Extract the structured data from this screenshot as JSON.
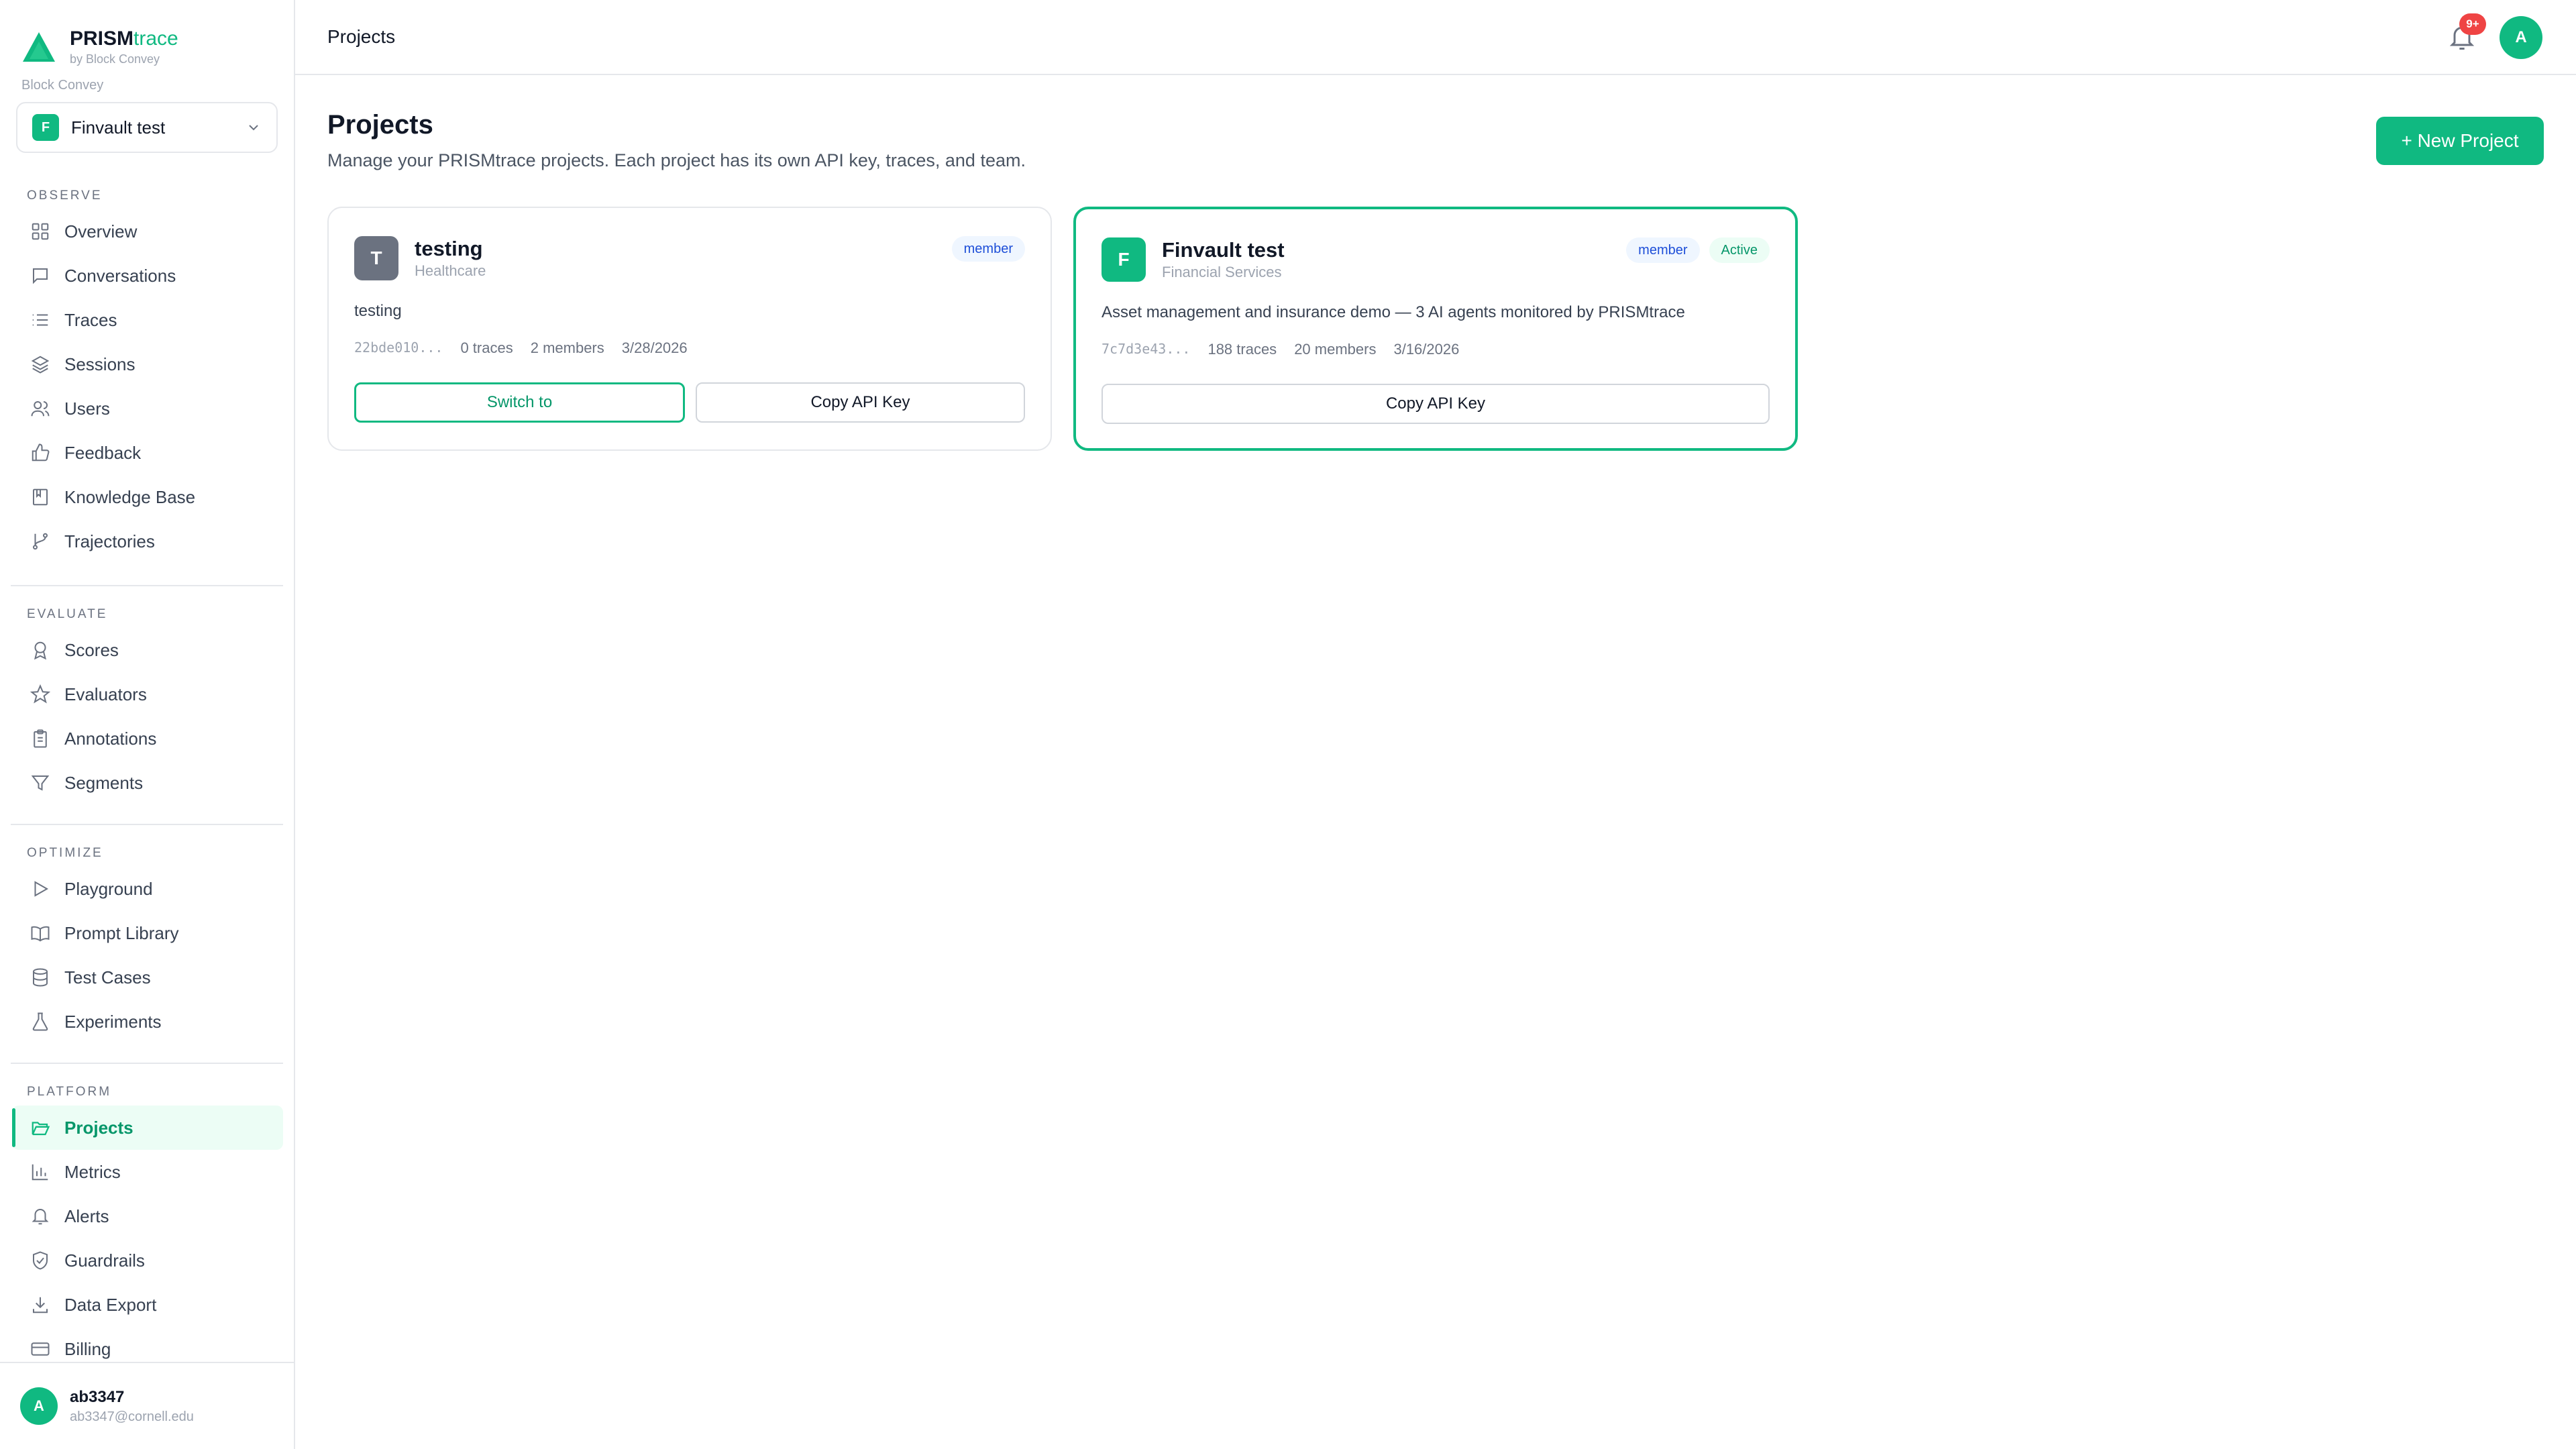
{
  "brand": {
    "name_main": "PRISM",
    "name_accent": "trace",
    "subtitle": "by Block Convey",
    "org": "Block Convey"
  },
  "project_selector": {
    "avatar": "F",
    "name": "Finvault test"
  },
  "sections": {
    "observe": "OBSERVE",
    "evaluate": "EVALUATE",
    "optimize": "OPTIMIZE",
    "platform": "PLATFORM"
  },
  "nav": {
    "overview": "Overview",
    "conversations": "Conversations",
    "traces": "Traces",
    "sessions": "Sessions",
    "users": "Users",
    "feedback": "Feedback",
    "knowledge_base": "Knowledge Base",
    "trajectories": "Trajectories",
    "scores": "Scores",
    "evaluators": "Evaluators",
    "annotations": "Annotations",
    "segments": "Segments",
    "playground": "Playground",
    "prompt_library": "Prompt Library",
    "test_cases": "Test Cases",
    "experiments": "Experiments",
    "projects": "Projects",
    "metrics": "Metrics",
    "alerts": "Alerts",
    "guardrails": "Guardrails",
    "data_export": "Data Export",
    "billing": "Billing"
  },
  "user": {
    "avatar": "A",
    "name": "ab3347",
    "email": "ab3347@cornell.edu"
  },
  "topbar": {
    "title": "Projects",
    "notif_count": "9+",
    "avatar": "A"
  },
  "page": {
    "title": "Projects",
    "description": "Manage your PRISMtrace projects. Each project has its own API key, traces, and team.",
    "new_button": "+ New Project"
  },
  "projects": [
    {
      "avatar": "T",
      "name": "testing",
      "industry": "Healthcare",
      "role": "member",
      "description": "testing",
      "key": "22bde010...",
      "traces": "0 traces",
      "members": "2 members",
      "date": "3/28/2026",
      "switch_label": "Switch to",
      "copy_label": "Copy API Key"
    },
    {
      "avatar": "F",
      "name": "Finvault test",
      "industry": "Financial Services",
      "role": "member",
      "status": "Active",
      "description": "Asset management and insurance demo — 3 AI agents monitored by PRISMtrace",
      "key": "7c7d3e43...",
      "traces": "188 traces",
      "members": "20 members",
      "date": "3/16/2026",
      "copy_label": "Copy API Key"
    }
  ],
  "colors": {
    "accent": "#10b981",
    "badge_red": "#ef4444",
    "member_badge": "#1d4ed8",
    "gray_avatar": "#6b7280"
  }
}
